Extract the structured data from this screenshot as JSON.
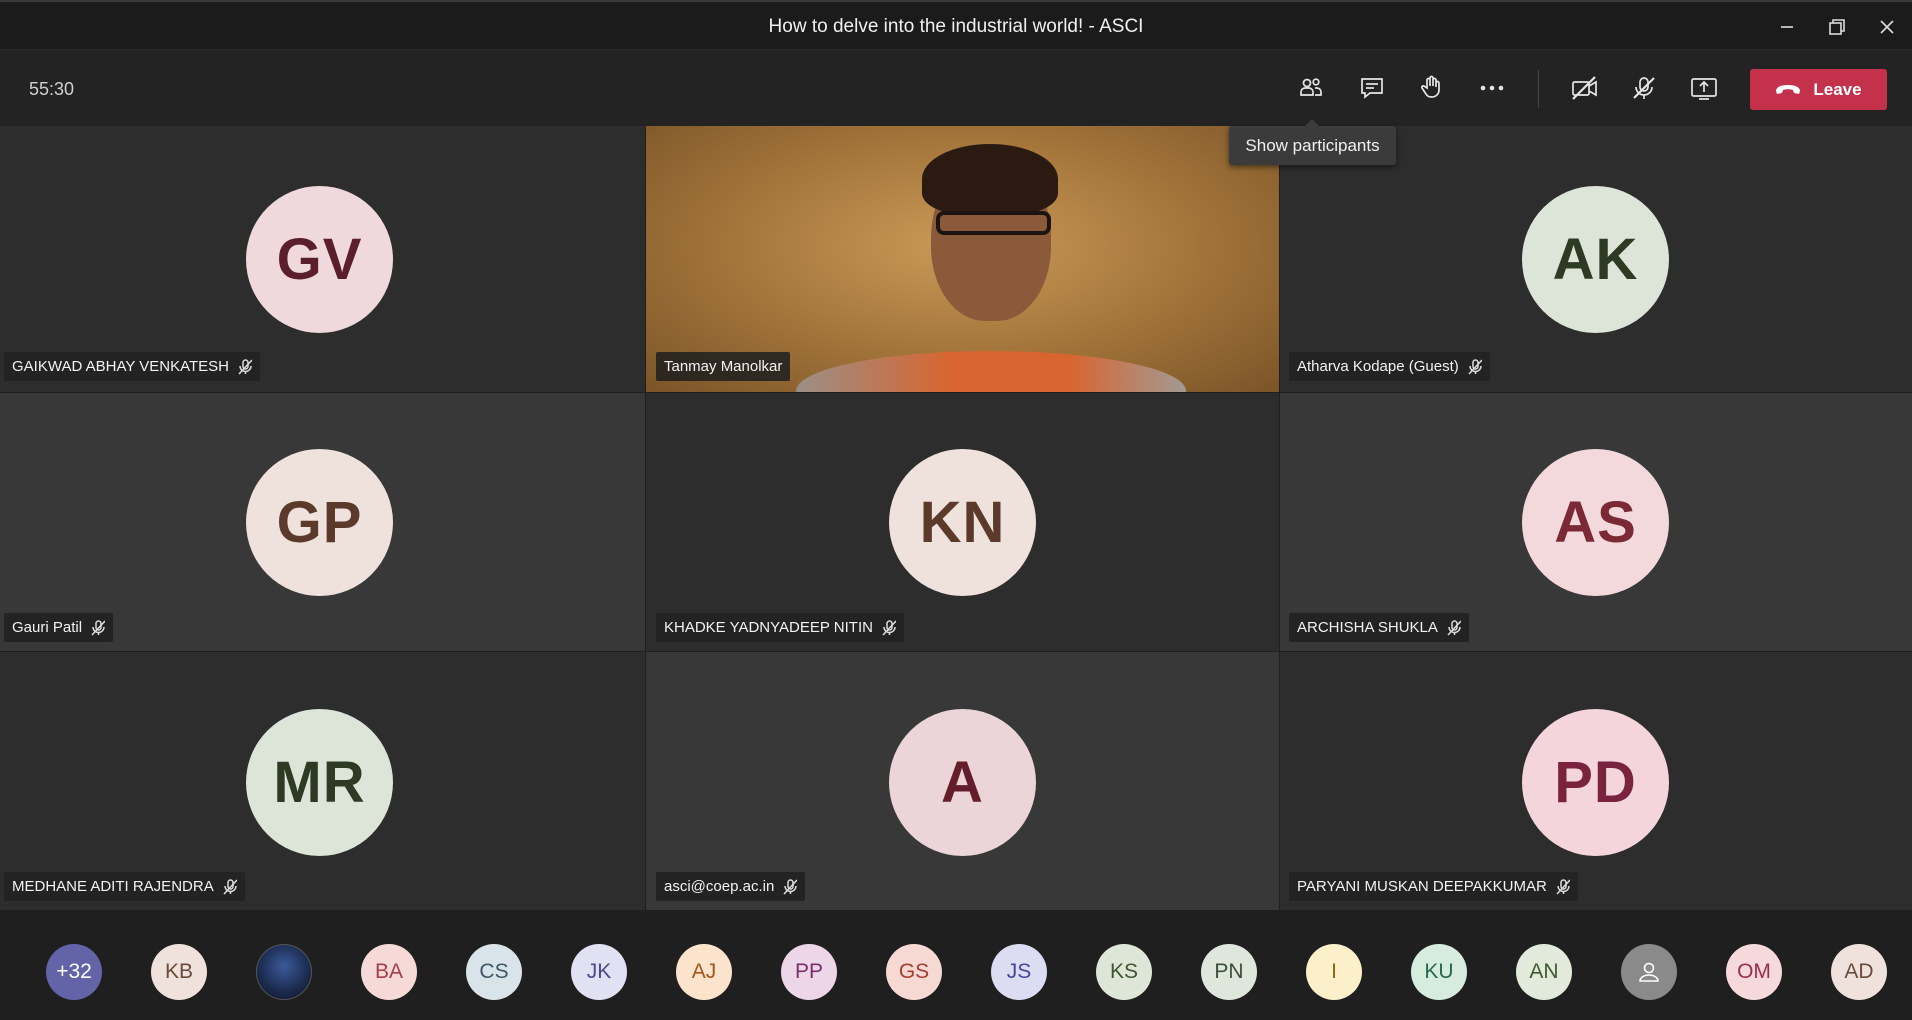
{
  "window": {
    "title": "How to delve into the industrial world! - ASCI"
  },
  "toolbar": {
    "timer": "55:30",
    "leave_label": "Leave",
    "tooltip": "Show participants"
  },
  "tiles": [
    {
      "name": "GAIKWAD ABHAY VENKATESH",
      "initials": "GV",
      "avatar_bg": "#efd9dc",
      "avatar_fg": "#5a1f2a",
      "muted": true
    },
    {
      "name": "Tanmay Manolkar",
      "initials": "",
      "video": true,
      "muted": false
    },
    {
      "name": "Atharva Kodape (Guest)",
      "initials": "AK",
      "avatar_bg": "#dde4d8",
      "avatar_fg": "#2d3a24",
      "muted": true
    },
    {
      "name": "Gauri Patil",
      "initials": "GP",
      "avatar_bg": "#efe2dc",
      "avatar_fg": "#5b3a2c",
      "muted": true
    },
    {
      "name": "KHADKE YADNYADEEP NITIN",
      "initials": "KN",
      "avatar_bg": "#efe2dc",
      "avatar_fg": "#5b3a2c",
      "muted": true
    },
    {
      "name": "ARCHISHA SHUKLA",
      "initials": "AS",
      "avatar_bg": "#f3d9dc",
      "avatar_fg": "#7a2935",
      "muted": true
    },
    {
      "name": "MEDHANE ADITI RAJENDRA",
      "initials": "MR",
      "avatar_bg": "#dde4d8",
      "avatar_fg": "#2d3a24",
      "muted": true
    },
    {
      "name": "asci@coep.ac.in",
      "initials": "A",
      "avatar_bg": "#ecd5d8",
      "avatar_fg": "#641d2a",
      "muted": true
    },
    {
      "name": "PARYANI MUSKAN DEEPAKKUMAR",
      "initials": "PD",
      "avatar_bg": "#f4d5dc",
      "avatar_fg": "#7a2340",
      "muted": true
    }
  ],
  "roster": [
    {
      "label": "+32",
      "bg": "#6264a7",
      "fg": "#ffffff"
    },
    {
      "label": "KB",
      "bg": "#efe2dc",
      "fg": "#6b4a3c"
    },
    {
      "label": "",
      "bg": "#243a66",
      "fg": "#ffffff",
      "photo": true
    },
    {
      "label": "BA",
      "bg": "#f6dad7",
      "fg": "#a3404a"
    },
    {
      "label": "CS",
      "bg": "#d9e4ea",
      "fg": "#3d5866"
    },
    {
      "label": "JK",
      "bg": "#e2e0f3",
      "fg": "#4b4a8a"
    },
    {
      "label": "AJ",
      "bg": "#fbe3cc",
      "fg": "#a0581f"
    },
    {
      "label": "PP",
      "bg": "#ecd6e8",
      "fg": "#7a2f6a"
    },
    {
      "label": "GS",
      "bg": "#f6d9d3",
      "fg": "#a23f32"
    },
    {
      "label": "JS",
      "bg": "#dcdcf3",
      "fg": "#45479a"
    },
    {
      "label": "KS",
      "bg": "#dde6d7",
      "fg": "#3f5533"
    },
    {
      "label": "PN",
      "bg": "#dfe6dc",
      "fg": "#3b4e37"
    },
    {
      "label": "I",
      "bg": "#fbf0c9",
      "fg": "#8a6a14"
    },
    {
      "label": "KU",
      "bg": "#d6ecdf",
      "fg": "#2b6a48"
    },
    {
      "label": "AN",
      "bg": "#e2eadb",
      "fg": "#3f5a2f"
    },
    {
      "label": "",
      "bg": "#8a8a8a",
      "fg": "#ffffff",
      "generic": true
    },
    {
      "label": "OM",
      "bg": "#f6d9dd",
      "fg": "#9a3048"
    },
    {
      "label": "AD",
      "bg": "#efe2dc",
      "fg": "#6b4a3c"
    }
  ]
}
